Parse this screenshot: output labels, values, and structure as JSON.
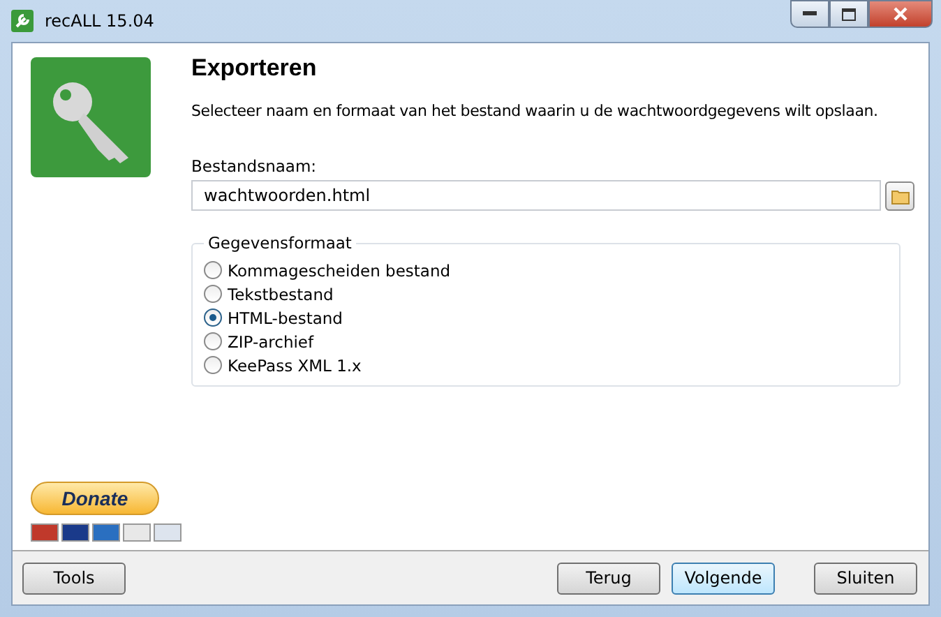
{
  "window": {
    "title": "recALL 15.04"
  },
  "heading": "Exporteren",
  "description": "Selecteer naam en formaat van het bestand waarin u de wachtwoordgegevens wilt opslaan.",
  "file": {
    "label": "Bestandsnaam:",
    "value": "wachtwoorden.html"
  },
  "format": {
    "legend": "Gegevensformaat",
    "options": [
      {
        "label": "Kommagescheiden bestand",
        "selected": false
      },
      {
        "label": "Tekstbestand",
        "selected": false
      },
      {
        "label": "HTML-bestand",
        "selected": true
      },
      {
        "label": "ZIP-archief",
        "selected": false
      },
      {
        "label": "KeePass XML 1.x",
        "selected": false
      }
    ]
  },
  "donate": {
    "label": "Donate"
  },
  "buttons": [
    {
      "label": "Tools",
      "kind": "left",
      "focused": false
    },
    {
      "label": "Terug",
      "kind": "right",
      "focused": false
    },
    {
      "label": "Volgende",
      "kind": "right",
      "focused": true
    },
    {
      "label": "Sluiten",
      "kind": "close",
      "focused": false
    }
  ]
}
